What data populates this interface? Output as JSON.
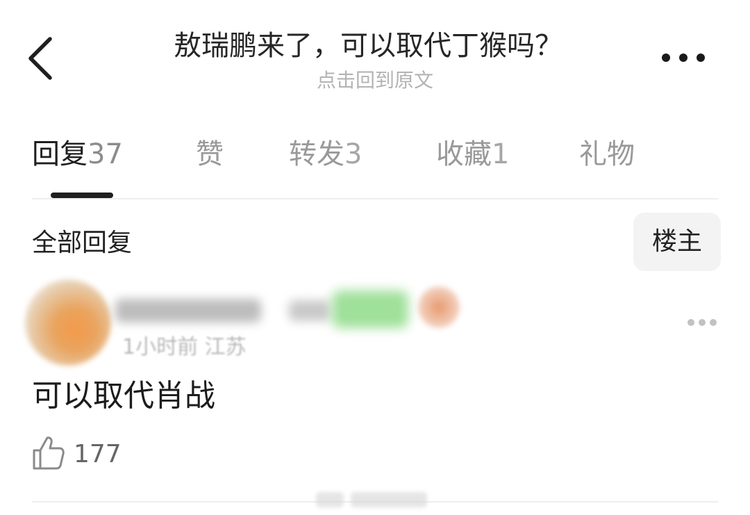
{
  "header": {
    "title": "敖瑞鹏来了，可以取代丁猴吗？",
    "subtitle": "点击回到原文"
  },
  "tabs": [
    {
      "label": "回复",
      "count": "37",
      "active": true
    },
    {
      "label": "赞",
      "count": ""
    },
    {
      "label": "转发",
      "count": "3"
    },
    {
      "label": "收藏",
      "count": "1"
    },
    {
      "label": "礼物",
      "count": ""
    }
  ],
  "section": {
    "title": "全部回复",
    "filter_label": "楼主"
  },
  "reply": {
    "content": "可以取代肖战",
    "meta": "1小时前 江苏",
    "likes": "177"
  },
  "icons": {
    "back": "chevron-left-icon",
    "more": "more-horizontal-icon",
    "like": "thumbs-up-icon"
  },
  "colors": {
    "text_primary": "#1f1f1f",
    "text_secondary": "#999999",
    "indicator": "#1f1f1f",
    "filter_bg": "#f3f3f3",
    "divider": "#eeeeee"
  }
}
